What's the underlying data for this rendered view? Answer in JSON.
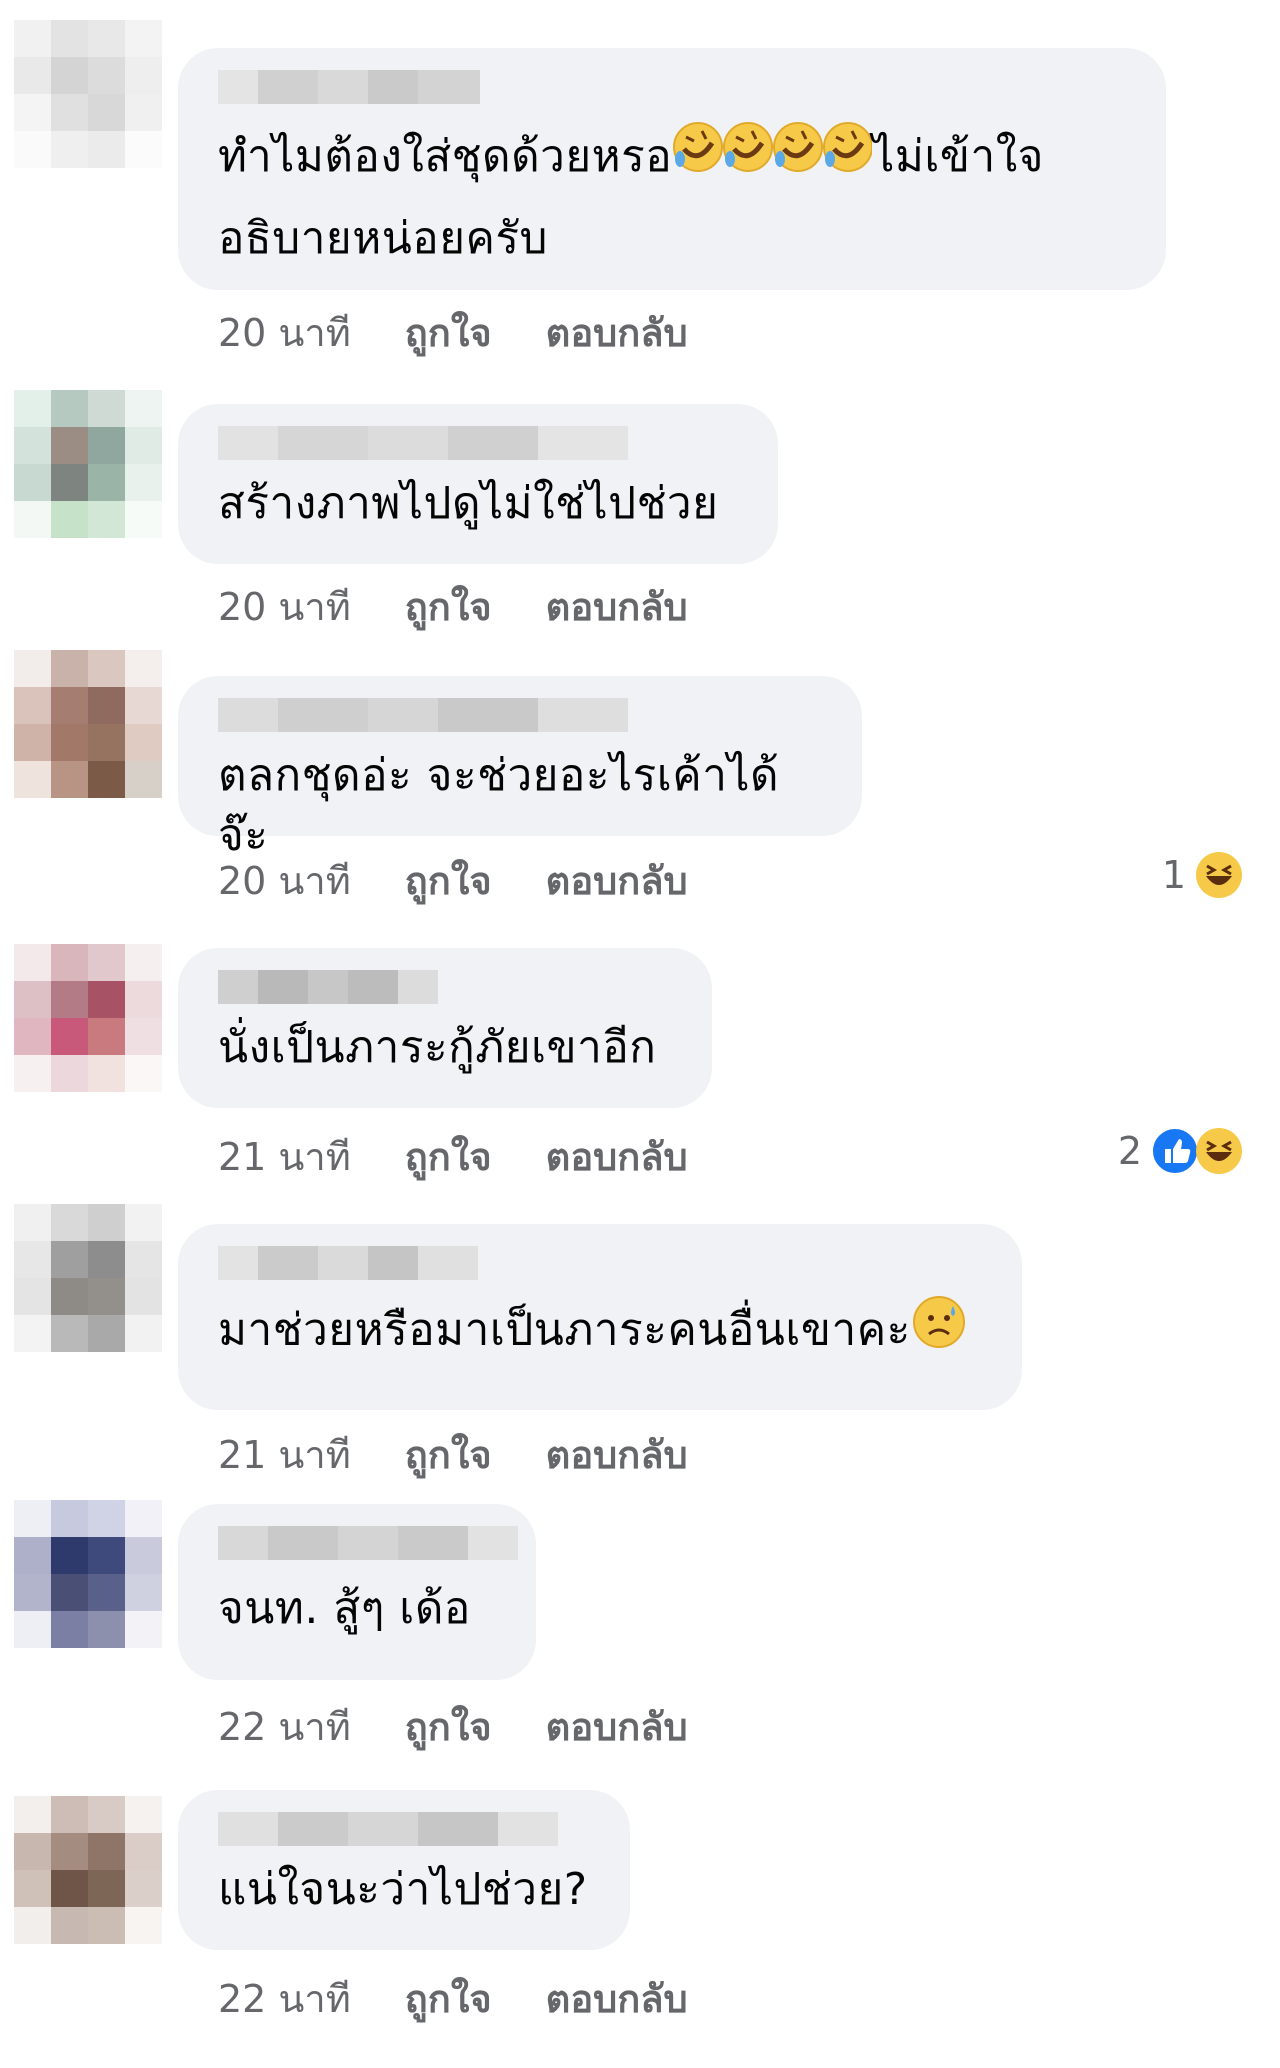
{
  "comments": [
    {
      "text": "ทำไมต้องใส่ชุดด้วยหรอ",
      "text_after": "ไม่เข้าใจ",
      "text_line2": "อธิบายหน่อยครับ",
      "time": "20 นาที",
      "like": "ถูกใจ",
      "reply": "ตอบกลับ",
      "inline_emoji": "rofl-emoji x4"
    },
    {
      "text": "สร้างภาพไปดูไม่ใช่ไปช่วย",
      "time": "20 นาที",
      "like": "ถูกใจ",
      "reply": "ตอบกลับ"
    },
    {
      "text": "ตลกชุดอ่ะ จะช่วยอะไรเค้าได้จ๊ะ",
      "time": "20 นาที",
      "like": "ถูกใจ",
      "reply": "ตอบกลับ",
      "reactions": {
        "count": "1",
        "icons": [
          "haha-icon"
        ]
      }
    },
    {
      "text": "นั่งเป็นภาระกู้ภัยเขาอีก",
      "time": "21 นาที",
      "like": "ถูกใจ",
      "reply": "ตอบกลับ",
      "reactions": {
        "count": "2",
        "icons": [
          "like-icon",
          "haha-icon"
        ]
      }
    },
    {
      "text": "มาช่วยหรือมาเป็นภาระคนอื่นเขาคะ",
      "time": "21 นาที",
      "like": "ถูกใจ",
      "reply": "ตอบกลับ",
      "inline_emoji": "sad-sweat-emoji"
    },
    {
      "text": "จนท. สู้ๆ เด้อ",
      "time": "22 นาที",
      "like": "ถูกใจ",
      "reply": "ตอบกลับ"
    },
    {
      "text": "แน่ใจนะว่าไปช่วย?",
      "time": "22 นาที",
      "like": "ถูกใจ",
      "reply": "ตอบกลับ"
    }
  ],
  "colors": {
    "bubble": "#f0f2f5",
    "meta": "#65676b",
    "like_blue": "#1877f2",
    "haha_yellow": "#f7c948"
  }
}
